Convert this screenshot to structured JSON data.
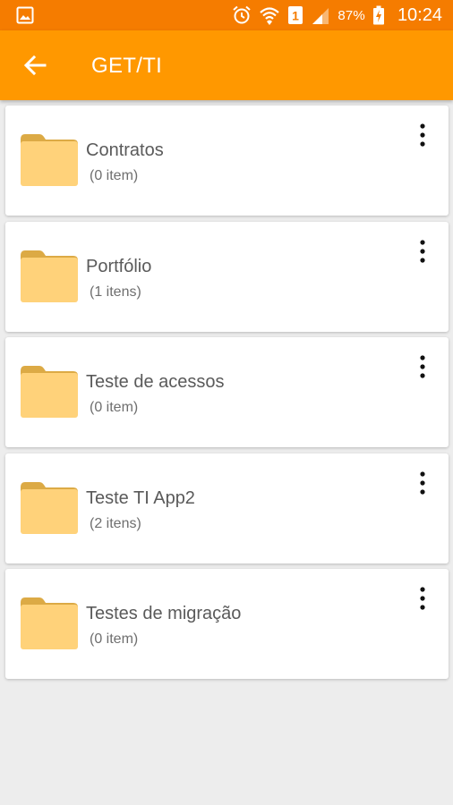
{
  "status_bar": {
    "battery_percent": "87%",
    "time": "10:24",
    "icons": [
      "image-notification-icon",
      "alarm-icon",
      "wifi-icon",
      "sim-1-icon",
      "signal-icon",
      "battery-charging-icon"
    ]
  },
  "app_bar": {
    "title": "GET/TI",
    "back_icon": "arrow-back-icon"
  },
  "colors": {
    "status_bar": "#f57c00",
    "app_bar": "#ff9800",
    "folder": "#ffd27a",
    "folder_tab": "#dcaa45",
    "background": "#ededed"
  },
  "folders": [
    {
      "name": "Contratos",
      "count": "(0 item)"
    },
    {
      "name": "Portfólio",
      "count": "(1 itens)"
    },
    {
      "name": "Teste de acessos",
      "count": "(0 item)"
    },
    {
      "name": "Teste TI App2",
      "count": "(2 itens)"
    },
    {
      "name": "Testes de migração",
      "count": "(0 item)"
    }
  ]
}
